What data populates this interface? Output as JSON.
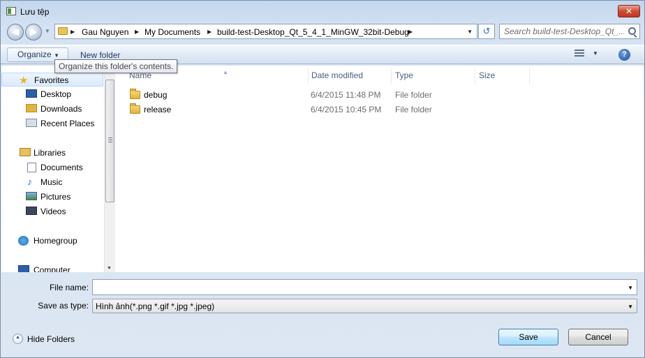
{
  "window": {
    "title": "Lưu tệp",
    "close_glyph": "✕"
  },
  "address": {
    "back_glyph": "◀",
    "forward_glyph": "▶",
    "crumbs": [
      "Gau Nguyen",
      "My Documents",
      "build-test-Desktop_Qt_5_4_1_MinGW_32bit-Debug"
    ],
    "crumb_separator": "▶",
    "dropdown_glyph": "▼",
    "refresh_glyph": "↺"
  },
  "search": {
    "placeholder": "Search build-test-Desktop_Qt_..."
  },
  "toolbar": {
    "organize_label": "Organize",
    "caret": "▼",
    "new_folder_label": "New folder",
    "help_glyph": "?",
    "tooltip": "Organize this folder's contents."
  },
  "nav": {
    "items": [
      {
        "label": "Favorites",
        "icon": "star-icon"
      },
      {
        "label": "Desktop",
        "icon": "desktop-icon"
      },
      {
        "label": "Downloads",
        "icon": "downloads-icon"
      },
      {
        "label": "Recent Places",
        "icon": "recent-places-icon"
      },
      {
        "label": "Libraries",
        "icon": "libraries-icon"
      },
      {
        "label": "Documents",
        "icon": "documents-icon"
      },
      {
        "label": "Music",
        "icon": "music-icon"
      },
      {
        "label": "Pictures",
        "icon": "pictures-icon"
      },
      {
        "label": "Videos",
        "icon": "videos-icon"
      },
      {
        "label": "Homegroup",
        "icon": "homegroup-icon"
      },
      {
        "label": "Computer",
        "icon": "computer-icon"
      }
    ],
    "scroll_down_glyph": "▼"
  },
  "columns": {
    "name": "Name",
    "date_modified": "Date modified",
    "type": "Type",
    "size": "Size",
    "sort_glyph": "▲"
  },
  "files": [
    {
      "name": "debug",
      "date": "6/4/2015 11:48 PM",
      "type": "File folder"
    },
    {
      "name": "release",
      "date": "6/4/2015 10:45 PM",
      "type": "File folder"
    }
  ],
  "form": {
    "file_name_label": "File name:",
    "file_name_value": "",
    "save_as_type_label": "Save as type:",
    "save_as_type_value": "Hình ảnh(*.png *.gif *.jpg *.jpeg)",
    "dropdown_glyph": "▼"
  },
  "footer": {
    "hide_folders_label": "Hide Folders",
    "save_label": "Save",
    "cancel_label": "Cancel"
  }
}
